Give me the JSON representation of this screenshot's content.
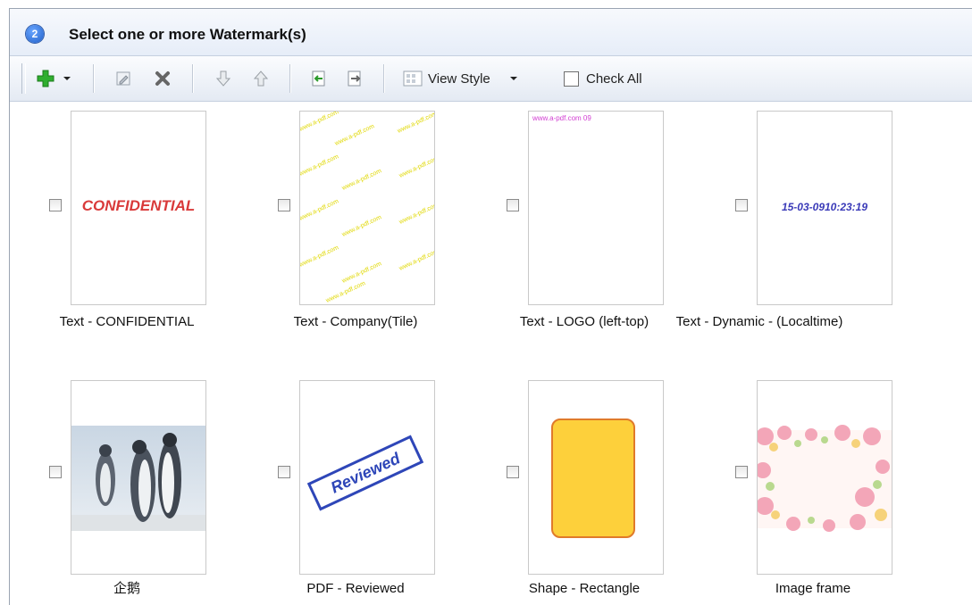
{
  "header": {
    "step_number": "2",
    "title": "Select one or more Watermark(s)"
  },
  "toolbar": {
    "items": [
      {
        "name": "add",
        "icon": "add-icon"
      },
      {
        "name": "add-dropdown",
        "icon": "chevron-down-icon"
      },
      {
        "name": "edit",
        "icon": "edit-icon"
      },
      {
        "name": "delete",
        "icon": "delete-icon"
      },
      {
        "name": "move-down",
        "icon": "arrow-down-icon"
      },
      {
        "name": "move-up",
        "icon": "arrow-up-icon"
      },
      {
        "name": "import",
        "icon": "import-icon"
      },
      {
        "name": "export",
        "icon": "export-icon"
      }
    ],
    "view_style_label": "View Style",
    "check_all_label": "Check All"
  },
  "watermarks": [
    {
      "caption": "Text - CONFIDENTIAL",
      "preview_text": "CONFIDENTIAL",
      "checked": false
    },
    {
      "caption": "Text - Company(Tile)",
      "preview_text": "www.a-pdf.com",
      "checked": false
    },
    {
      "caption": "Text - LOGO (left-top)",
      "preview_text": "www.a-pdf.com 09",
      "checked": false
    },
    {
      "caption": "Text - Dynamic - (Localtime)",
      "preview_text": "15-03-0910:23:19",
      "checked": false
    },
    {
      "caption": "企鹅",
      "preview_text": "",
      "checked": false
    },
    {
      "caption": "PDF - Reviewed",
      "preview_text": "Reviewed",
      "checked": false
    },
    {
      "caption": "Shape - Rectangle",
      "preview_text": "",
      "checked": false
    },
    {
      "caption": "Image frame",
      "preview_text": "",
      "checked": false
    }
  ],
  "colors": {
    "confidential": "#d93a3a",
    "tile_text": "#e0d800",
    "logo_text": "#d23fd2",
    "dynamic_text": "#3a3ab8",
    "reviewed": "#2e46b8",
    "shape_fill": "#fdd03b",
    "shape_stroke": "#e07a2a"
  }
}
